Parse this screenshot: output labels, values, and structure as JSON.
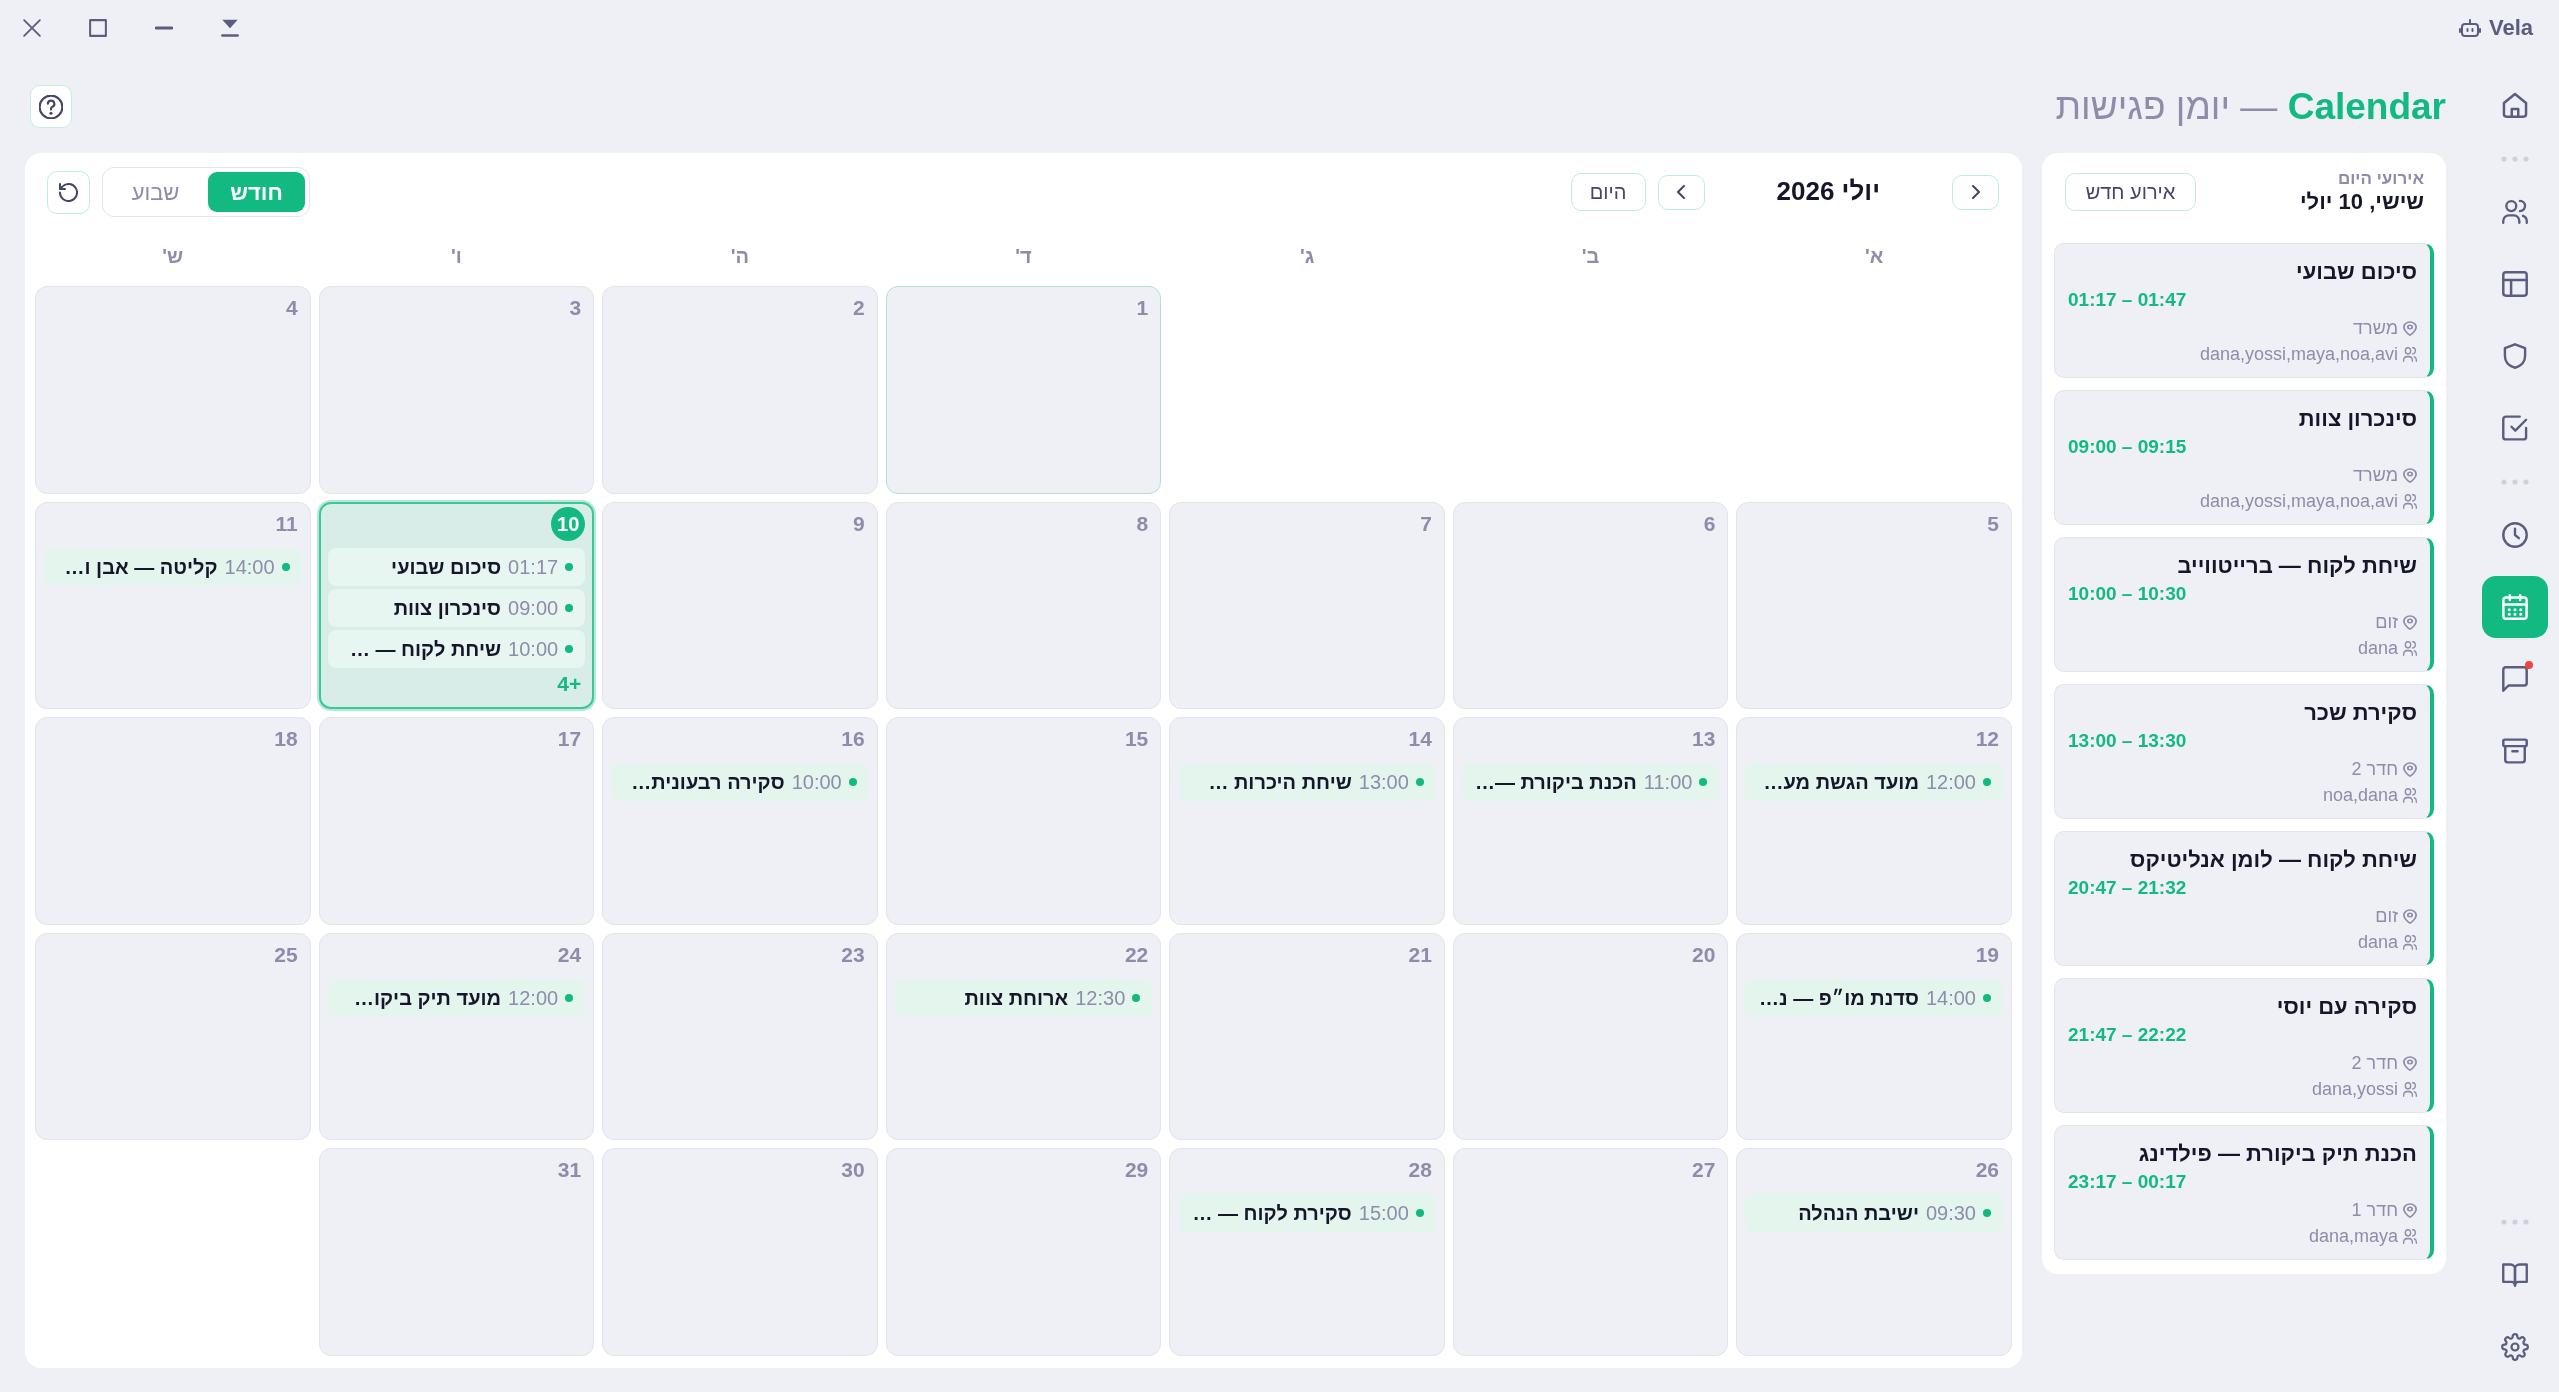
{
  "title_bar": {
    "app_name": "Vela"
  },
  "header": {
    "title": "**Calendar** — יומן פגישות"
  },
  "sidebar": {
    "groups": [
      {
        "items": [
          {
            "selected": false,
            "unread": false
          }
        ]
      },
      {
        "items": [
          {
            "selected": false,
            "unread": false
          },
          {
            "selected": false,
            "unread": false
          },
          {
            "selected": false,
            "unread": false
          },
          {
            "selected": false,
            "unread": false
          }
        ]
      },
      {
        "items": [
          {
            "selected": false,
            "unread": false
          },
          {
            "selected": true,
            "unread": false
          },
          {
            "selected": false,
            "unread": true
          },
          {
            "selected": false,
            "unread": false
          }
        ]
      },
      {
        "items": [
          {
            "selected": false,
            "unread": false
          },
          {
            "selected": false,
            "unread": false
          }
        ]
      }
    ]
  },
  "calendar": {
    "month_title": "יולי 2026",
    "today_button": "היום",
    "view_tabs": [
      {
        "label": "חודש",
        "selected": true
      },
      {
        "label": "שבוע",
        "selected": false
      }
    ],
    "weekdays": [
      "א'",
      "ב'",
      "ג'",
      "ד'",
      "ה'",
      "ו'",
      "ש'"
    ],
    "weeks": [
      [
        {
          "kind": "blank"
        },
        {
          "kind": "blank"
        },
        {
          "kind": "blank"
        },
        {
          "kind": "day",
          "day": "1",
          "today": false,
          "focused": true
        },
        {
          "kind": "day",
          "day": "2",
          "today": false,
          "focused": false
        },
        {
          "kind": "day",
          "day": "3",
          "today": false,
          "focused": false
        },
        {
          "kind": "day",
          "day": "4",
          "today": false,
          "focused": false
        }
      ],
      [
        {
          "kind": "day",
          "day": "5",
          "today": false,
          "focused": false
        },
        {
          "kind": "day",
          "day": "6",
          "today": false,
          "focused": false
        },
        {
          "kind": "day",
          "day": "7",
          "today": false,
          "focused": false
        },
        {
          "kind": "day",
          "day": "8",
          "today": false,
          "focused": false
        },
        {
          "kind": "day",
          "day": "9",
          "today": false,
          "focused": false
        },
        {
          "kind": "day",
          "day": "10",
          "today": true,
          "focused": false,
          "events": [
            {
              "time": "01:17",
              "title": "סיכום שבועי"
            },
            {
              "time": "09:00",
              "title": "סינכרון צוות"
            },
            {
              "time": "10:00",
              "title": "שיחת לקוח — …"
            }
          ],
          "more": "+4"
        },
        {
          "kind": "day",
          "day": "11",
          "today": false,
          "focused": false,
          "events": [
            {
              "time": "14:00",
              "title": "קליטה — אבן ו…"
            }
          ]
        }
      ],
      [
        {
          "kind": "day",
          "day": "12",
          "today": false,
          "focused": false,
          "events": [
            {
              "time": "12:00",
              "title": "מועד הגשת מע…"
            }
          ]
        },
        {
          "kind": "day",
          "day": "13",
          "today": false,
          "focused": false,
          "events": [
            {
              "time": "11:00",
              "title": "הכנת ביקורת —…"
            }
          ]
        },
        {
          "kind": "day",
          "day": "14",
          "today": false,
          "focused": false,
          "events": [
            {
              "time": "13:00",
              "title": "שיחת היכרות …"
            }
          ]
        },
        {
          "kind": "day",
          "day": "15",
          "today": false,
          "focused": false
        },
        {
          "kind": "day",
          "day": "16",
          "today": false,
          "focused": false,
          "events": [
            {
              "time": "10:00",
              "title": "סקירה רבעונית…"
            }
          ]
        },
        {
          "kind": "day",
          "day": "17",
          "today": false,
          "focused": false
        },
        {
          "kind": "day",
          "day": "18",
          "today": false,
          "focused": false
        }
      ],
      [
        {
          "kind": "day",
          "day": "19",
          "today": false,
          "focused": false,
          "events": [
            {
              "time": "14:00",
              "title": "סדנת מו״פ — נ…"
            }
          ]
        },
        {
          "kind": "day",
          "day": "20",
          "today": false,
          "focused": false
        },
        {
          "kind": "day",
          "day": "21",
          "today": false,
          "focused": false
        },
        {
          "kind": "day",
          "day": "22",
          "today": false,
          "focused": false,
          "events": [
            {
              "time": "12:30",
              "title": "ארוחת צוות"
            }
          ]
        },
        {
          "kind": "day",
          "day": "23",
          "today": false,
          "focused": false
        },
        {
          "kind": "day",
          "day": "24",
          "today": false,
          "focused": false,
          "events": [
            {
              "time": "12:00",
              "title": "מועד תיק ביקו…"
            }
          ]
        },
        {
          "kind": "day",
          "day": "25",
          "today": false,
          "focused": false
        }
      ],
      [
        {
          "kind": "day",
          "day": "26",
          "today": false,
          "focused": false,
          "events": [
            {
              "time": "09:30",
              "title": "ישיבת הנהלה"
            }
          ]
        },
        {
          "kind": "day",
          "day": "27",
          "today": false,
          "focused": false
        },
        {
          "kind": "day",
          "day": "28",
          "today": false,
          "focused": false,
          "events": [
            {
              "time": "15:00",
              "title": "סקירת לקוח — …"
            }
          ]
        },
        {
          "kind": "day",
          "day": "29",
          "today": false,
          "focused": false
        },
        {
          "kind": "day",
          "day": "30",
          "today": false,
          "focused": false
        },
        {
          "kind": "day",
          "day": "31",
          "today": false,
          "focused": false
        },
        {
          "kind": "blank"
        }
      ]
    ]
  },
  "today_panel": {
    "label": "אירועי היום",
    "date": "שישי, 10 יולי",
    "new_button": "אירוע חדש",
    "events": [
      {
        "title": "סיכום שבועי",
        "time": "01:17 – 01:47",
        "location": "משרד",
        "attendees": "dana,yossi,maya,noa,avi"
      },
      {
        "title": "סינכרון צוות",
        "time": "09:00 – 09:15",
        "location": "משרד",
        "attendees": "dana,yossi,maya,noa,avi"
      },
      {
        "title": "שיחת לקוח — ברייטווייב",
        "time": "10:00 – 10:30",
        "location": "זום",
        "attendees": "dana"
      },
      {
        "title": "סקירת שכר",
        "time": "13:00 – 13:30",
        "location": "חדר 2",
        "attendees": "noa,dana"
      },
      {
        "title": "שיחת לקוח — לומן אנליטיקס",
        "time": "20:47 – 21:32",
        "location": "זום",
        "attendees": "dana"
      },
      {
        "title": "סקירה עם יוסי",
        "time": "21:47 – 22:22",
        "location": "חדר 2",
        "attendees": "dana,yossi"
      },
      {
        "title": "הכנת תיק ביקורת — פילדינג",
        "time": "23:17 – 00:17",
        "location": "חדר 1",
        "attendees": "dana,maya"
      }
    ]
  }
}
